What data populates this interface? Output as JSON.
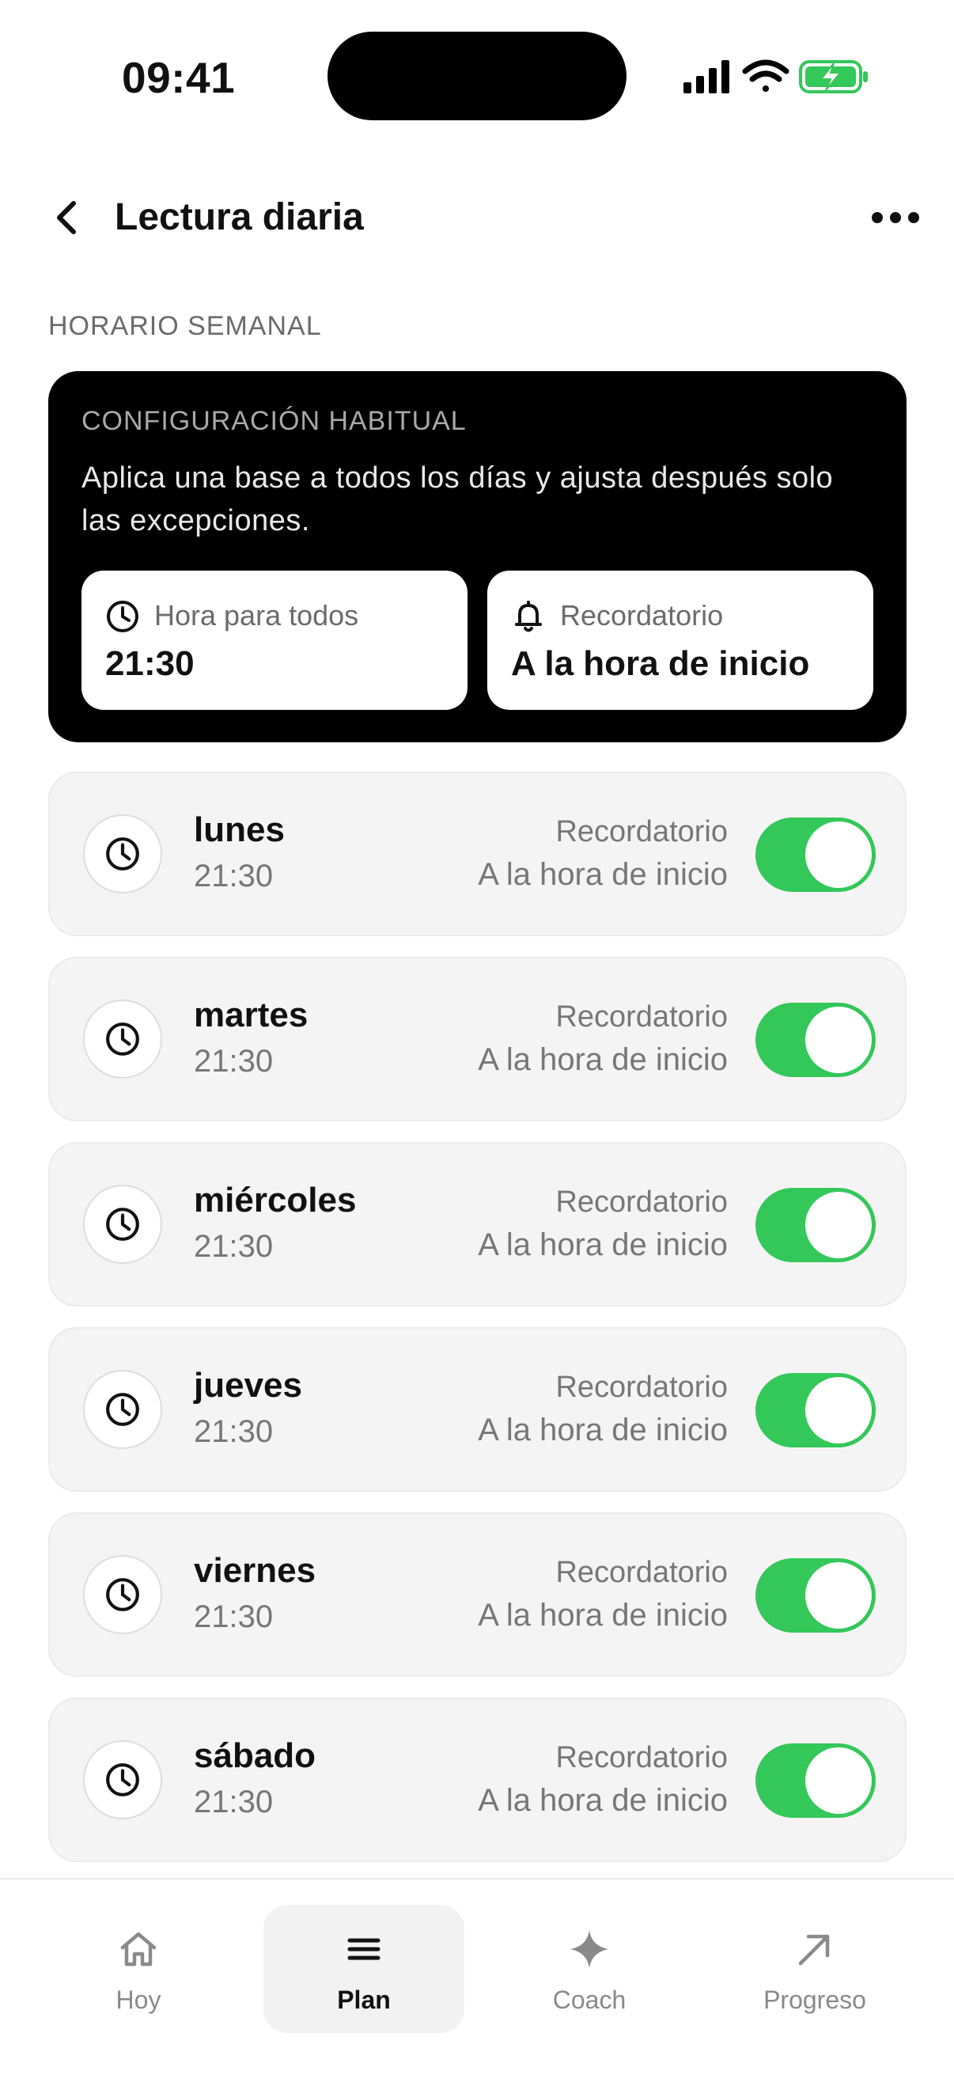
{
  "status_bar": {
    "time": "09:41"
  },
  "header": {
    "title": "Lectura diaria"
  },
  "section_label": "HORARIO SEMANAL",
  "base_config": {
    "label": "CONFIGURACIÓN HABITUAL",
    "description": "Aplica una base a todos los días y ajusta después solo las excepciones.",
    "time_tile": {
      "label": "Hora para todos",
      "value": "21:30",
      "icon": "clock-icon"
    },
    "reminder_tile": {
      "label": "Recordatorio",
      "value": "A la hora de inicio",
      "icon": "bell-icon"
    }
  },
  "days": [
    {
      "name": "lunes",
      "time": "21:30",
      "reminder_label": "Recordatorio",
      "reminder_value": "A la hora de inicio",
      "enabled": true
    },
    {
      "name": "martes",
      "time": "21:30",
      "reminder_label": "Recordatorio",
      "reminder_value": "A la hora de inicio",
      "enabled": true
    },
    {
      "name": "miércoles",
      "time": "21:30",
      "reminder_label": "Recordatorio",
      "reminder_value": "A la hora de inicio",
      "enabled": true
    },
    {
      "name": "jueves",
      "time": "21:30",
      "reminder_label": "Recordatorio",
      "reminder_value": "A la hora de inicio",
      "enabled": true
    },
    {
      "name": "viernes",
      "time": "21:30",
      "reminder_label": "Recordatorio",
      "reminder_value": "A la hora de inicio",
      "enabled": true
    },
    {
      "name": "sábado",
      "time": "21:30",
      "reminder_label": "Recordatorio",
      "reminder_value": "A la hora de inicio",
      "enabled": true
    }
  ],
  "tab_bar": {
    "tabs": [
      {
        "label": "Hoy",
        "icon": "home-icon",
        "active": false
      },
      {
        "label": "Plan",
        "icon": "menu-icon",
        "active": true
      },
      {
        "label": "Coach",
        "icon": "sparkle-icon",
        "active": false
      },
      {
        "label": "Progreso",
        "icon": "arrow-up-right-icon",
        "active": false
      }
    ]
  },
  "colors": {
    "accent_toggle": "#34c759",
    "card_dark": "#000000",
    "row_bg": "#f4f4f4"
  }
}
